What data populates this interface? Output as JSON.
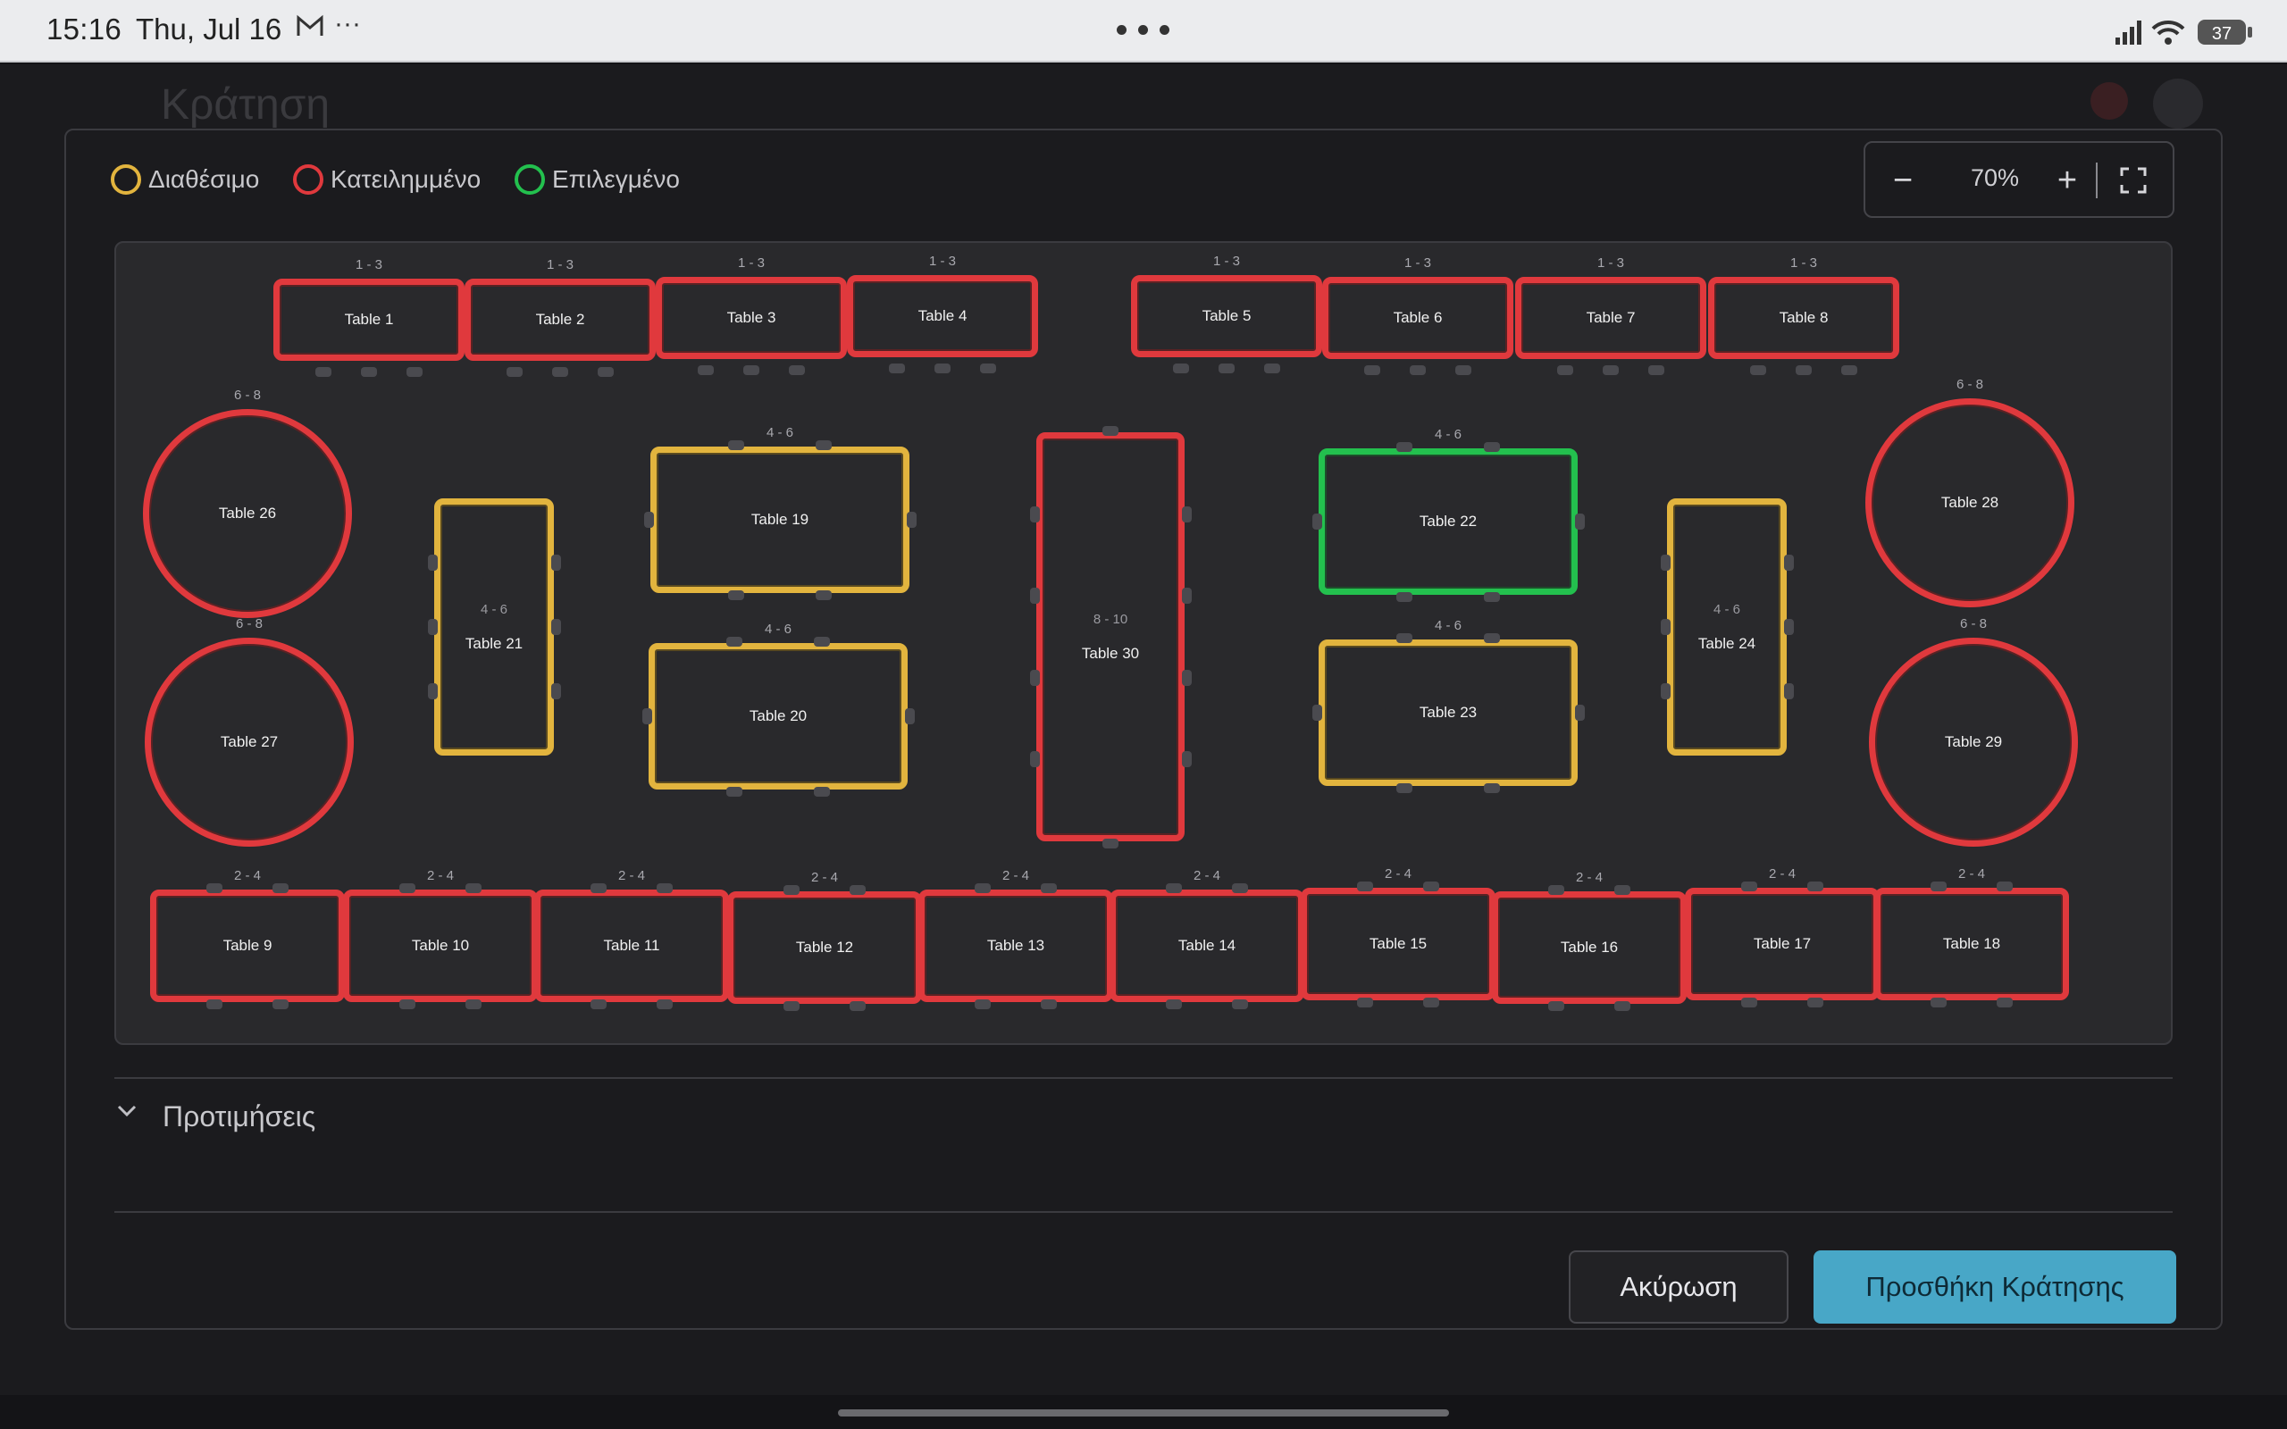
{
  "status_bar": {
    "time": "15:16",
    "date": "Thu, Jul 16",
    "mail_icon": "gmail-icon",
    "more": "···",
    "battery": "37"
  },
  "background": {
    "title": "Κράτηση"
  },
  "legend": {
    "available": "Διαθέσιμο",
    "occupied": "Κατειλημμένο",
    "selected": "Επιλεγμένο",
    "colors": {
      "available": "#e2b43e",
      "occupied": "#e0393d",
      "selected": "#23c04e"
    }
  },
  "zoom": {
    "minus": "−",
    "value": "70%",
    "plus": "+",
    "fullscreen_icon": "fullscreen-icon"
  },
  "tables": [
    {
      "id": 1,
      "name": "Table 1",
      "capacity": "1 - 3",
      "status": "occupied",
      "shape": "rect"
    },
    {
      "id": 2,
      "name": "Table 2",
      "capacity": "1 - 3",
      "status": "occupied",
      "shape": "rect"
    },
    {
      "id": 3,
      "name": "Table 3",
      "capacity": "1 - 3",
      "status": "occupied",
      "shape": "rect"
    },
    {
      "id": 4,
      "name": "Table 4",
      "capacity": "1 - 3",
      "status": "occupied",
      "shape": "rect"
    },
    {
      "id": 5,
      "name": "Table 5",
      "capacity": "1 - 3",
      "status": "occupied",
      "shape": "rect"
    },
    {
      "id": 6,
      "name": "Table 6",
      "capacity": "1 - 3",
      "status": "occupied",
      "shape": "rect"
    },
    {
      "id": 7,
      "name": "Table 7",
      "capacity": "1 - 3",
      "status": "occupied",
      "shape": "rect"
    },
    {
      "id": 8,
      "name": "Table 8",
      "capacity": "1 - 3",
      "status": "occupied",
      "shape": "rect"
    },
    {
      "id": 9,
      "name": "Table 9",
      "capacity": "2 - 4",
      "status": "occupied",
      "shape": "rect"
    },
    {
      "id": 10,
      "name": "Table 10",
      "capacity": "2 - 4",
      "status": "occupied",
      "shape": "rect"
    },
    {
      "id": 11,
      "name": "Table 11",
      "capacity": "2 - 4",
      "status": "occupied",
      "shape": "rect"
    },
    {
      "id": 12,
      "name": "Table 12",
      "capacity": "2 - 4",
      "status": "occupied",
      "shape": "rect"
    },
    {
      "id": 13,
      "name": "Table 13",
      "capacity": "2 - 4",
      "status": "occupied",
      "shape": "rect"
    },
    {
      "id": 14,
      "name": "Table 14",
      "capacity": "2 - 4",
      "status": "occupied",
      "shape": "rect"
    },
    {
      "id": 15,
      "name": "Table 15",
      "capacity": "2 - 4",
      "status": "occupied",
      "shape": "rect"
    },
    {
      "id": 16,
      "name": "Table 16",
      "capacity": "2 - 4",
      "status": "occupied",
      "shape": "rect"
    },
    {
      "id": 17,
      "name": "Table 17",
      "capacity": "2 - 4",
      "status": "occupied",
      "shape": "rect"
    },
    {
      "id": 18,
      "name": "Table 18",
      "capacity": "2 - 4",
      "status": "occupied",
      "shape": "rect"
    },
    {
      "id": 19,
      "name": "Table 19",
      "capacity": "4 - 6",
      "status": "available",
      "shape": "rect"
    },
    {
      "id": 20,
      "name": "Table 20",
      "capacity": "4 - 6",
      "status": "available",
      "shape": "rect"
    },
    {
      "id": 21,
      "name": "Table 21",
      "capacity": "4 - 6",
      "status": "available",
      "shape": "rect"
    },
    {
      "id": 22,
      "name": "Table 22",
      "capacity": "4 - 6",
      "status": "selected",
      "shape": "rect"
    },
    {
      "id": 23,
      "name": "Table 23",
      "capacity": "4 - 6",
      "status": "available",
      "shape": "rect"
    },
    {
      "id": 24,
      "name": "Table 24",
      "capacity": "4 - 6",
      "status": "available",
      "shape": "rect"
    },
    {
      "id": 26,
      "name": "Table 26",
      "capacity": "6 - 8",
      "status": "occupied",
      "shape": "round"
    },
    {
      "id": 27,
      "name": "Table 27",
      "capacity": "6 - 8",
      "status": "occupied",
      "shape": "round"
    },
    {
      "id": 28,
      "name": "Table 28",
      "capacity": "6 - 8",
      "status": "occupied",
      "shape": "round"
    },
    {
      "id": 29,
      "name": "Table 29",
      "capacity": "6 - 8",
      "status": "occupied",
      "shape": "round"
    },
    {
      "id": 30,
      "name": "Table 30",
      "capacity": "8 - 10",
      "status": "occupied",
      "shape": "rect"
    }
  ],
  "preferences": {
    "label": "Προτιμήσεις",
    "chevron_icon": "chevron-down-icon"
  },
  "actions": {
    "cancel": "Ακύρωση",
    "add": "Προσθήκη Κράτησης"
  }
}
